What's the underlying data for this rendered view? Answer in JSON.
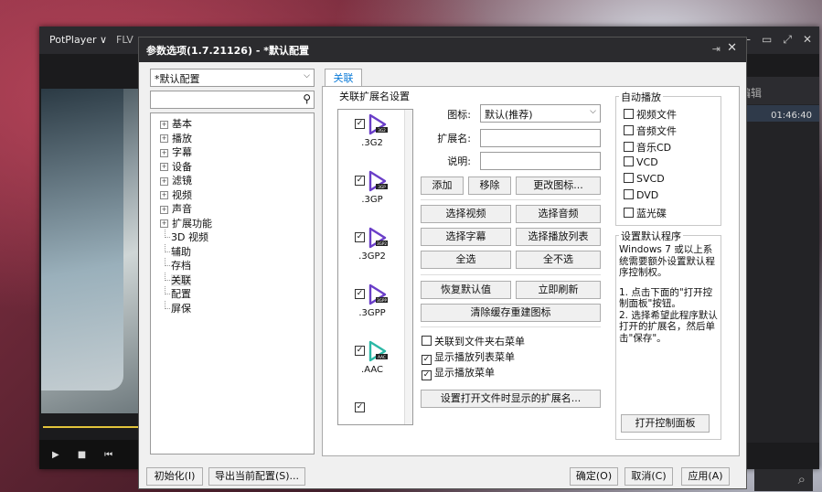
{
  "potplayer": {
    "logo": "PotPlayer ∨",
    "format": "FLV",
    "right_header": "编辑",
    "right_time": "01:46:40"
  },
  "dialog": {
    "title": "参数选项(1.7.21126) - *默认配置",
    "pin": "⇥",
    "close": "✕",
    "profile": "*默认配置",
    "tab": "关联",
    "tree": [
      {
        "label": "基本",
        "expandable": true
      },
      {
        "label": "播放",
        "expandable": true
      },
      {
        "label": "字幕",
        "expandable": true
      },
      {
        "label": "设备",
        "expandable": true
      },
      {
        "label": "滤镜",
        "expandable": true
      },
      {
        "label": "视频",
        "expandable": true
      },
      {
        "label": "声音",
        "expandable": true
      },
      {
        "label": "扩展功能",
        "expandable": true
      },
      {
        "label": "3D 视频",
        "expandable": false
      },
      {
        "label": "辅助",
        "expandable": false
      },
      {
        "label": "存档",
        "expandable": false
      },
      {
        "label": "关联",
        "expandable": false,
        "selected": true
      },
      {
        "label": "配置",
        "expandable": false
      },
      {
        "label": "屏保",
        "expandable": false
      }
    ],
    "assoc": {
      "group_title": "关联扩展名设置",
      "extensions": [
        {
          "name": ".3G2",
          "checked": true,
          "tag": "3G2",
          "color": "#6a3ec8"
        },
        {
          "name": ".3GP",
          "checked": true,
          "tag": "3GP",
          "color": "#6a3ec8"
        },
        {
          "name": ".3GP2",
          "checked": true,
          "tag": "3GP2",
          "color": "#6a3ec8"
        },
        {
          "name": ".3GPP",
          "checked": true,
          "tag": "3GPP",
          "color": "#6a3ec8"
        },
        {
          "name": ".AAC",
          "checked": true,
          "tag": "AAC",
          "color": "#2bb8a6"
        }
      ],
      "icon_label": "图标:",
      "icon_value": "默认(推荐)",
      "ext_label": "扩展名:",
      "desc_label": "说明:",
      "btn_add": "添加",
      "btn_remove": "移除",
      "btn_change_icon": "更改图标...",
      "btn_select_video": "选择视频",
      "btn_select_audio": "选择音频",
      "btn_select_subtitle": "选择字幕",
      "btn_select_playlist": "选择播放列表",
      "btn_select_all": "全选",
      "btn_select_none": "全不选",
      "btn_restore": "恢复默认值",
      "btn_refresh": "立即刷新",
      "btn_clear_cache": "清除缓存重建图标",
      "cb_folder_menu": {
        "label": "关联到文件夹右菜单",
        "checked": false
      },
      "cb_playlist_menu": {
        "label": "显示播放列表菜单",
        "checked": true
      },
      "cb_play_menu": {
        "label": "显示播放菜单",
        "checked": true
      },
      "btn_set_open_ext": "设置打开文件时显示的扩展名..."
    },
    "autoplay": {
      "title": "自动播放",
      "items": [
        {
          "label": "视频文件",
          "checked": false
        },
        {
          "label": "音频文件",
          "checked": false
        },
        {
          "label": "音乐CD",
          "checked": false
        },
        {
          "label": "VCD",
          "checked": false
        },
        {
          "label": "SVCD",
          "checked": false
        },
        {
          "label": "DVD",
          "checked": false
        },
        {
          "label": "蓝光碟",
          "checked": false
        }
      ]
    },
    "default_program": {
      "title": "设置默认程序",
      "text1": "Windows 7 或以上系统需要额外设置默认程序控制权。",
      "text2": "1. 点击下面的\"打开控制面板\"按钮。",
      "text3": "2. 选择希望此程序默认打开的扩展名，然后单击\"保存\"。",
      "btn": "打开控制面板"
    },
    "footer": {
      "init": "初始化(I)",
      "export": "导出当前配置(S)...",
      "ok": "确定(O)",
      "cancel": "取消(C)",
      "apply": "应用(A)"
    }
  }
}
